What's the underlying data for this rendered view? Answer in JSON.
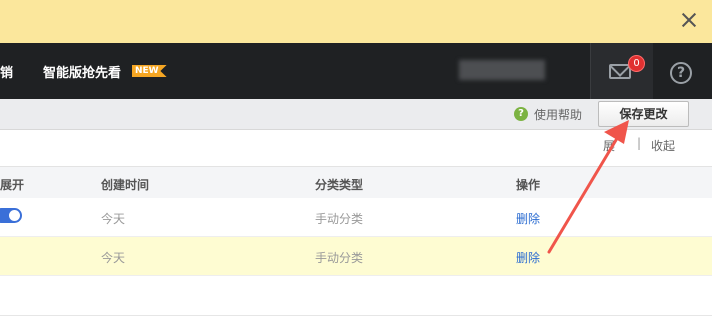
{
  "nav": {
    "cut_item": "销",
    "smart_item": "智能版抢先看",
    "new_badge": "NEW",
    "mail_count": "0",
    "help_symbol": "?"
  },
  "toolbar": {
    "help_link": "使用帮助",
    "save_label": "保存更改"
  },
  "view_controls": {
    "expand": "展",
    "separator": "|",
    "collapse": "收起"
  },
  "table": {
    "headers": {
      "expand": "默认展开",
      "created": "创建时间",
      "type": "分类类型",
      "actions": "操作"
    },
    "rows": [
      {
        "created": "今天",
        "type": "手动分类",
        "action": "删除",
        "toggle_on": true
      },
      {
        "created": "今天",
        "type": "手动分类",
        "action": "删除",
        "highlighted": true
      }
    ]
  },
  "icons": [
    "close-icon",
    "mail-icon",
    "help-icon",
    "help-q-icon",
    "toggle-switch"
  ],
  "colors": {
    "notice_bg": "#fbe79c",
    "nav_bg": "#1f2123",
    "badge": "#f5a623",
    "mail_count_bg": "#e03131",
    "link": "#2b6cd1",
    "highlight_row": "#fefcd2",
    "annotation_arrow": "#f0554b"
  }
}
